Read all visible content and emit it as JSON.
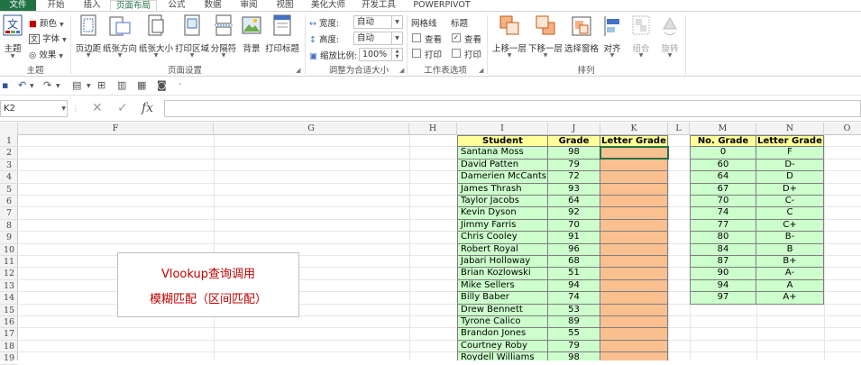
{
  "tabs": [
    "文件",
    "开始",
    "插入",
    "页面布局",
    "公式",
    "数据",
    "审阅",
    "视图",
    "美化大师",
    "开发工具",
    "POWERPIVOT"
  ],
  "active_tab": "页面布局",
  "ribbon": {
    "theme": {
      "big_label": "主题",
      "items": [
        "颜色",
        "字体",
        "效果"
      ],
      "group_label": "主题"
    },
    "page_setup": {
      "buttons": [
        "页边距",
        "纸张方向",
        "纸张大小",
        "打印区域",
        "分隔符",
        "背景",
        "打印标题"
      ],
      "group_label": "页面设置"
    },
    "scale": {
      "width_label": "宽度:",
      "width_value": "自动",
      "height_label": "高度:",
      "height_value": "自动",
      "scale_label": "缩放比例:",
      "scale_value": "100%",
      "group_label": "调整为合适大小"
    },
    "sheet_options": {
      "gridlines_label": "网格线",
      "headings_label": "标题",
      "view_label": "查看",
      "print_label": "打印",
      "group_label": "工作表选项"
    },
    "arrange": {
      "buttons": [
        "上移一层",
        "下移一层",
        "选择窗格",
        "对齐",
        "组合",
        "旋转"
      ],
      "group_label": "排列"
    }
  },
  "formula_bar": {
    "name_box": "K2",
    "cancel_icon": "✕",
    "enter_icon": "✓",
    "fx_label": "fx",
    "value": ""
  },
  "columns": [
    "F",
    "G",
    "H",
    "I",
    "J",
    "K",
    "L",
    "M",
    "N",
    "O"
  ],
  "rows": [
    "1",
    "2",
    "3",
    "4",
    "5",
    "6",
    "7",
    "8",
    "9",
    "10",
    "11",
    "12",
    "13",
    "14",
    "15",
    "16",
    "17",
    "18",
    "19"
  ],
  "table1": {
    "headers": [
      "Student",
      "Grade",
      "Letter Grade"
    ],
    "rows": [
      [
        "Santana Moss",
        "98"
      ],
      [
        "David Patten",
        "79"
      ],
      [
        "Damerien McCants",
        "72"
      ],
      [
        "James Thrash",
        "93"
      ],
      [
        "Taylor Jacobs",
        "64"
      ],
      [
        "Kevin Dyson",
        "92"
      ],
      [
        "Jimmy Farris",
        "70"
      ],
      [
        "Chris Cooley",
        "91"
      ],
      [
        "Robert Royal",
        "96"
      ],
      [
        "Jabari Holloway",
        "68"
      ],
      [
        "Brian Kozlowski",
        "51"
      ],
      [
        "Mike Sellers",
        "94"
      ],
      [
        "Billy Baber",
        "74"
      ],
      [
        "Drew Bennett",
        "53"
      ],
      [
        "Tyrone Calico",
        "89"
      ],
      [
        "Brandon Jones",
        "55"
      ],
      [
        "Courtney Roby",
        "79"
      ],
      [
        "Roydell Williams",
        "98"
      ]
    ]
  },
  "table2": {
    "headers": [
      "No. Grade",
      "Letter Grade"
    ],
    "rows": [
      [
        "0",
        "F"
      ],
      [
        "60",
        "D-"
      ],
      [
        "64",
        "D"
      ],
      [
        "67",
        "D+"
      ],
      [
        "70",
        "C-"
      ],
      [
        "74",
        "C"
      ],
      [
        "77",
        "C+"
      ],
      [
        "80",
        "B-"
      ],
      [
        "84",
        "B"
      ],
      [
        "87",
        "B+"
      ],
      [
        "90",
        "A-"
      ],
      [
        "94",
        "A"
      ],
      [
        "97",
        "A+"
      ]
    ]
  },
  "note": {
    "line1": "Vlookup查询调用",
    "line2": "模糊匹配（区间匹配）"
  },
  "colors": {
    "header_fill": "#ffff99",
    "green_fill": "#ccffcc",
    "orange_fill": "#fac090",
    "note_text": "#c00000",
    "excel_green": "#217346"
  }
}
